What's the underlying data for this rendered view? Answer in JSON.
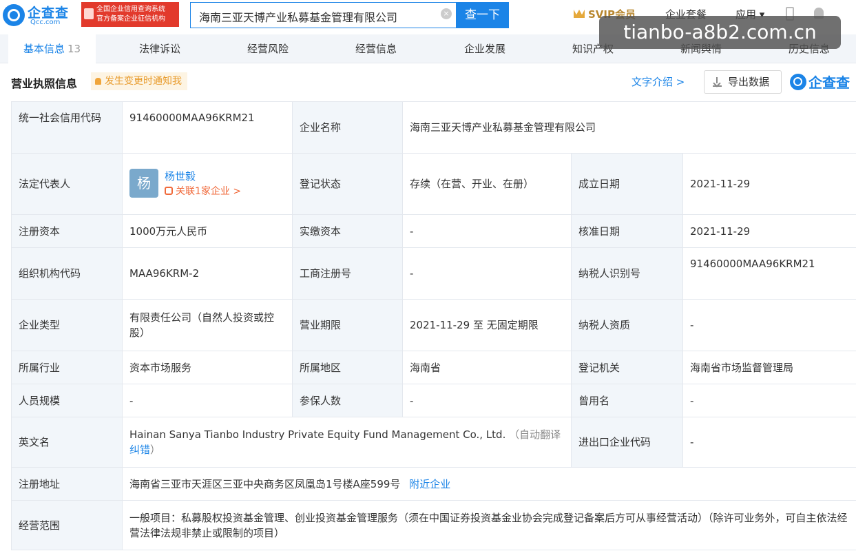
{
  "header": {
    "logo_cn": "企查查",
    "logo_en": "Qcc.com",
    "badge_line1": "全国企业信用查询系统",
    "badge_line2": "官方备案企业征信机构",
    "search_value": "海南三亚天博产业私募基金管理有限公司",
    "search_button": "查一下",
    "svip": "SVIP会员",
    "nav_package": "企业套餐",
    "nav_apps": "应用"
  },
  "watermark": "tianbo-a8b2.com.cn",
  "tabs": [
    {
      "label": "基本信息",
      "count": "13"
    },
    {
      "label": "法律诉讼"
    },
    {
      "label": "经营风险"
    },
    {
      "label": "经营信息"
    },
    {
      "label": "企业发展"
    },
    {
      "label": "知识产权"
    },
    {
      "label": "新闻舆情"
    },
    {
      "label": "历史信息"
    }
  ],
  "section": {
    "title": "营业执照信息",
    "notify": "发生变更时通知我",
    "text_intro": "文字介绍 >",
    "export": "导出数据",
    "brand": "企查查"
  },
  "rows": {
    "credit_code": {
      "label": "统一社会信用代码",
      "value": "91460000MAA96KRM21"
    },
    "company_name": {
      "label": "企业名称",
      "value": "海南三亚天博产业私募基金管理有限公司"
    },
    "legal_rep": {
      "label": "法定代表人",
      "avatar": "杨",
      "name": "杨世毅",
      "related": "关联1家企业 >"
    },
    "reg_status": {
      "label": "登记状态",
      "value": "存续（在营、开业、在册）"
    },
    "founded": {
      "label": "成立日期",
      "value": "2021-11-29"
    },
    "reg_capital": {
      "label": "注册资本",
      "value": "1000万元人民币"
    },
    "paid_capital": {
      "label": "实缴资本",
      "value": "-"
    },
    "approved": {
      "label": "核准日期",
      "value": "2021-11-29"
    },
    "org_code": {
      "label": "组织机构代码",
      "value": "MAA96KRM-2"
    },
    "biz_reg_no": {
      "label": "工商注册号",
      "value": "-"
    },
    "taxpayer_id": {
      "label": "纳税人识别号",
      "value": "91460000MAA96KRM21"
    },
    "company_type": {
      "label": "企业类型",
      "value": "有限责任公司（自然人投资或控股）"
    },
    "biz_term": {
      "label": "营业期限",
      "value": "2021-11-29 至 无固定期限"
    },
    "taxpayer_qual": {
      "label": "纳税人资质",
      "value": "-"
    },
    "industry": {
      "label": "所属行业",
      "value": "资本市场服务"
    },
    "region": {
      "label": "所属地区",
      "value": "海南省"
    },
    "authority": {
      "label": "登记机关",
      "value": "海南省市场监督管理局"
    },
    "staff_size": {
      "label": "人员规模",
      "value": "-"
    },
    "insured": {
      "label": "参保人数",
      "value": "-"
    },
    "former_name": {
      "label": "曾用名",
      "value": "-"
    },
    "english_name": {
      "label": "英文名",
      "value": "Hainan Sanya Tianbo Industry Private Equity Fund Management Co., Ltd.",
      "auto": "（自动翻译",
      "fix": "纠错",
      "close": "）"
    },
    "import_export": {
      "label": "进出口企业代码",
      "value": "-"
    },
    "address": {
      "label": "注册地址",
      "value": "海南省三亚市天涯区三亚中央商务区凤凰岛1号楼A座599号",
      "nearby": "附近企业"
    },
    "scope": {
      "label": "经营范围",
      "value": "一般项目：私募股权投资基金管理、创业投资基金管理服务（须在中国证券投资基金业协会完成登记备案后方可从事经营活动）（除许可业务外，可自主依法经营法律法规非禁止或限制的项目）"
    }
  }
}
